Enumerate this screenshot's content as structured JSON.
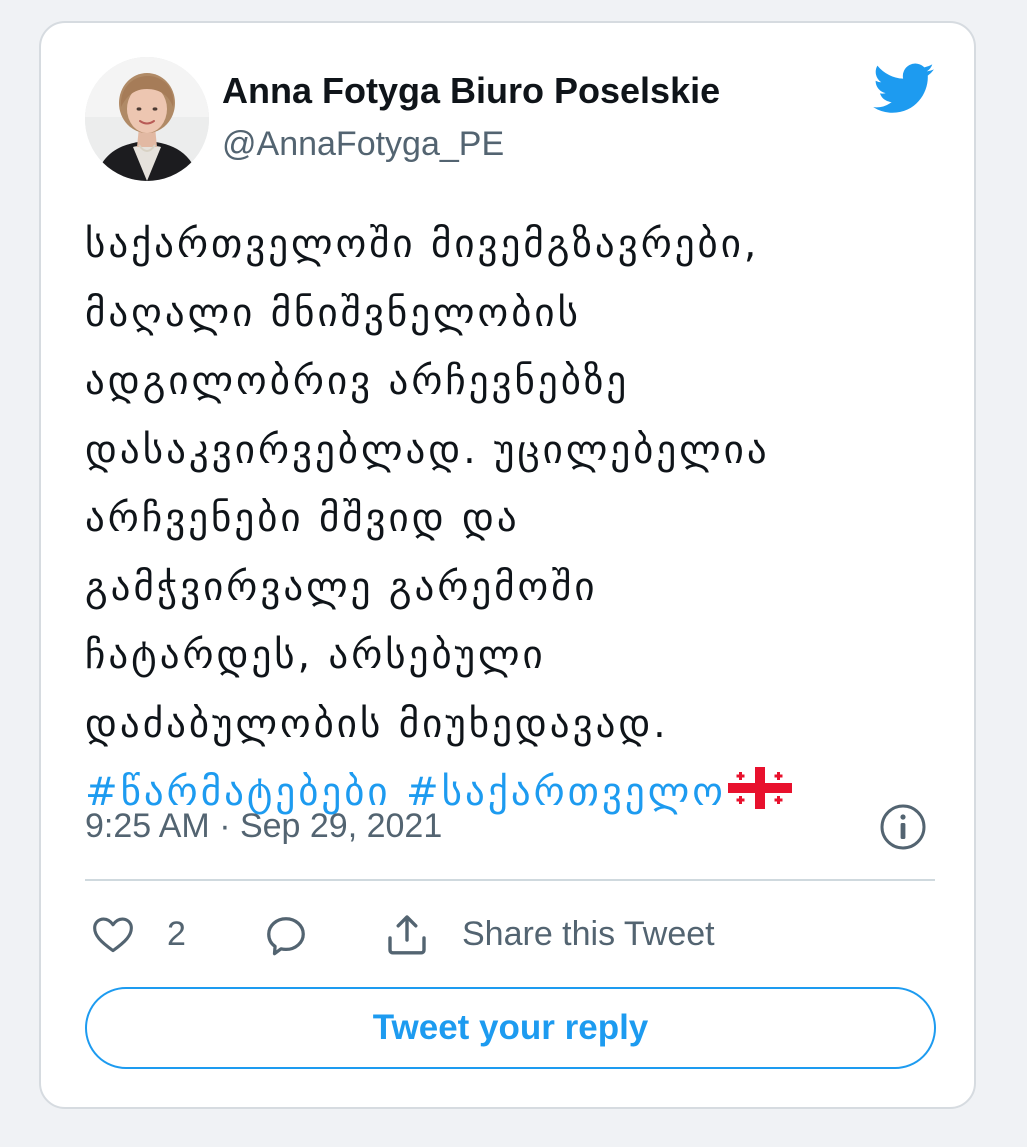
{
  "author": {
    "display_name": "Anna Fotyga Biuro Poselskie",
    "handle": "@AnnaFotyga_PE"
  },
  "tweet": {
    "lines": [
      "საქართველოში მივემგზავრები,",
      "მაღალი მნიშვნელობის",
      "ადგილობრივ არჩევნებზე",
      "დასაკვირვებლად. უცილებელია",
      "არჩვენები მშვიდ და",
      "გამჭვირვალე გარემოში",
      "ჩატარდეს, არსებული",
      "დაძაბულობის მიუხედავად."
    ],
    "hashtags": [
      "#წარმატებები",
      "#საქართველო"
    ],
    "flag_emoji": "georgia-flag",
    "timestamp": "9:25 AM · Sep 29, 2021"
  },
  "actions": {
    "like_count": "2",
    "share_label": "Share this Tweet",
    "reply_button_label": "Tweet your reply"
  },
  "icons": {
    "brand": "twitter-bird-icon",
    "info": "info-icon",
    "like": "heart-icon",
    "reply": "reply-bubble-icon",
    "share": "share-icon"
  },
  "colors": {
    "accent": "#1d9bf0",
    "text": "#0f1419",
    "secondary_text": "#536471",
    "border": "#cfd9de",
    "background": "#f0f2f5"
  }
}
